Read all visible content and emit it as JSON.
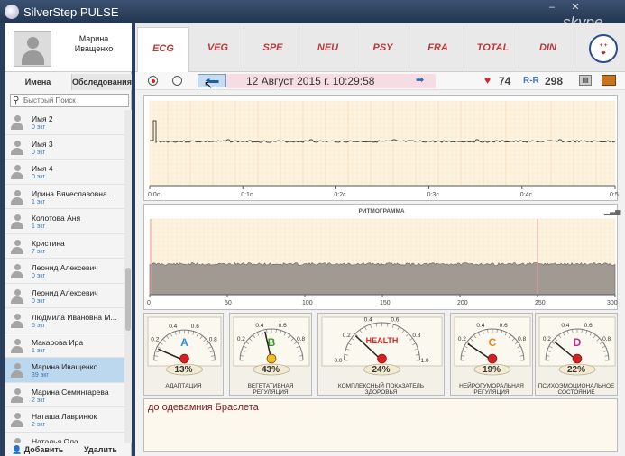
{
  "window": {
    "title": "SilverStep PULSE",
    "watermark": "skype"
  },
  "profile": {
    "name_line1": "Марина",
    "name_line2": "Иващенко"
  },
  "sidebar": {
    "tabs": [
      "Имена",
      "Обследования"
    ],
    "search_placeholder": "Быстрый Поиск",
    "patients": [
      {
        "name": "Имя 2",
        "count": "0 экг"
      },
      {
        "name": "Имя 3",
        "count": "0 экг"
      },
      {
        "name": "Имя 4",
        "count": "0 экг"
      },
      {
        "name": "Ирина Вячеславовна...",
        "count": "1 экг"
      },
      {
        "name": "Колотова Аня",
        "count": "1 экг"
      },
      {
        "name": "Кристина",
        "count": "7 экг"
      },
      {
        "name": "Леонид Алексевич",
        "count": "0 экг"
      },
      {
        "name": "Леонид Алексевич",
        "count": "0 экг"
      },
      {
        "name": "Людмила Ивановна М...",
        "count": "5 экг"
      },
      {
        "name": "Макарова Ира",
        "count": "1 экг"
      },
      {
        "name": "Марина Иващенко",
        "count": "39 экг"
      },
      {
        "name": "Марина Семингарева",
        "count": "2 экг"
      },
      {
        "name": "Наташа Лавринюк",
        "count": "2 экг"
      },
      {
        "name": "Наталья Ола",
        "count": ""
      }
    ],
    "selected_index": 10,
    "add_label": "Добавить",
    "delete_label": "Удалить"
  },
  "nav": {
    "tabs": [
      "ECG",
      "VEG",
      "SPE",
      "NEU",
      "PSY",
      "FRA",
      "TOTAL",
      "DIN"
    ],
    "active_index": 0
  },
  "toolbar": {
    "datetime": "12 Август 2015 г. 10:29:58",
    "heart_rate": "74",
    "rr_label": "R-R",
    "rr_value": "298"
  },
  "ecg": {
    "ticks": [
      "0:0c",
      "0:1c",
      "0:2c",
      "0:3c",
      "0:4c",
      "0:5"
    ]
  },
  "rhythm": {
    "title": "РИТМОГРАММА",
    "ticks": [
      "0",
      "50",
      "100",
      "150",
      "200",
      "250",
      "300"
    ]
  },
  "gauges": [
    {
      "letter": "A",
      "percent": "13%",
      "label": "АДАПТАЦИЯ",
      "label2": "",
      "value": 0.13,
      "color": "#2f8fe0"
    },
    {
      "letter": "B",
      "percent": "43%",
      "label": "ВЕГЕТАТИВНАЯ",
      "label2": "РЕГУЛЯЦИЯ",
      "value": 0.43,
      "color": "#3a9a2a"
    },
    {
      "letter": "HEALTH",
      "percent": "24%",
      "label": "КОМПЛЕКСНЫЙ ПОКАЗАТЕЛЬ",
      "label2": "ЗДОРОВЬЯ",
      "value": 0.24,
      "color": "#d22"
    },
    {
      "letter": "C",
      "percent": "19%",
      "label": "НЕЙРОГУМОРАЛЬНАЯ",
      "label2": "РЕГУЛЯЦИЯ",
      "value": 0.19,
      "color": "#e88a1a"
    },
    {
      "letter": "D",
      "percent": "22%",
      "label": "ПСИХОЭМОЦИОНАЛЬНОЕ",
      "label2": "СОСТОЯНИЕ",
      "value": 0.22,
      "color": "#c22a8a"
    }
  ],
  "gauge_scale": [
    "0.0",
    "0.2",
    "0.4",
    "0.6",
    "0.8",
    "1.0"
  ],
  "notes": {
    "text": "до одевамния Браслета"
  }
}
